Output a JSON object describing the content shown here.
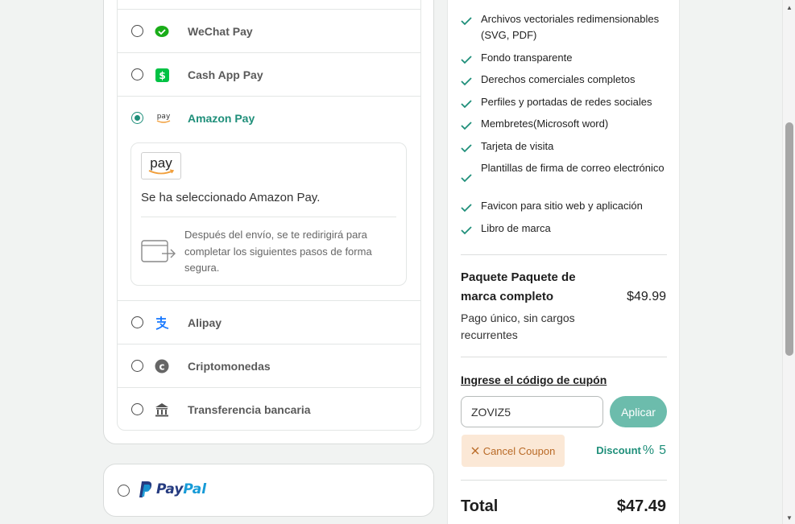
{
  "payment_methods": [
    {
      "label": "WeChat Pay",
      "icon": "wechat-icon",
      "selected": false
    },
    {
      "label": "Cash App Pay",
      "icon": "cash-app-icon",
      "selected": false
    },
    {
      "label": "Amazon Pay",
      "icon": "amazon-pay-icon",
      "selected": true
    },
    {
      "label": "Alipay",
      "icon": "alipay-icon",
      "selected": false
    },
    {
      "label": "Criptomonedas",
      "icon": "crypto-icon",
      "selected": false
    },
    {
      "label": "Transferencia bancaria",
      "icon": "bank-icon",
      "selected": false
    }
  ],
  "amazon_pay": {
    "logo_text": "pay",
    "selected_text": "Se ha seleccionado Amazon Pay.",
    "info_text": "Después del envío, se te redirigirá para completar los siguientes pasos de forma segura."
  },
  "paypal": {
    "pay": "Pay",
    "pal": "Pal"
  },
  "summary": {
    "features": [
      "Archivos vectoriales redimensionables (SVG, PDF)",
      "Fondo transparente",
      "Derechos comerciales completos",
      "Perfiles y portadas de redes sociales",
      "Membretes(Microsoft word)",
      "Tarjeta de visita",
      "Plantillas de firma de correo electrónico",
      "Favicon para sitio web y aplicación",
      "Libro de marca"
    ],
    "package_title": "Paquete Paquete de marca completo",
    "package_subtitle": "Pago único, sin cargos recurrentes",
    "package_price": "$49.99",
    "coupon_label": "Ingrese el código de cupón",
    "coupon_value": "ZOVIZ5",
    "apply_label": "Aplicar",
    "cancel_coupon_label": "Cancel Coupon",
    "discount_label": "Discount",
    "discount_pct": "%",
    "discount_value": "5",
    "total_label": "Total",
    "total_value": "$47.49"
  },
  "colors": {
    "accent": "#1f8f7a",
    "apply_button": "#6cbcac",
    "cancel_bg": "#fbe8d6",
    "cancel_text": "#b96a26",
    "paypal_dark": "#253b80",
    "paypal_light": "#179bd7"
  }
}
